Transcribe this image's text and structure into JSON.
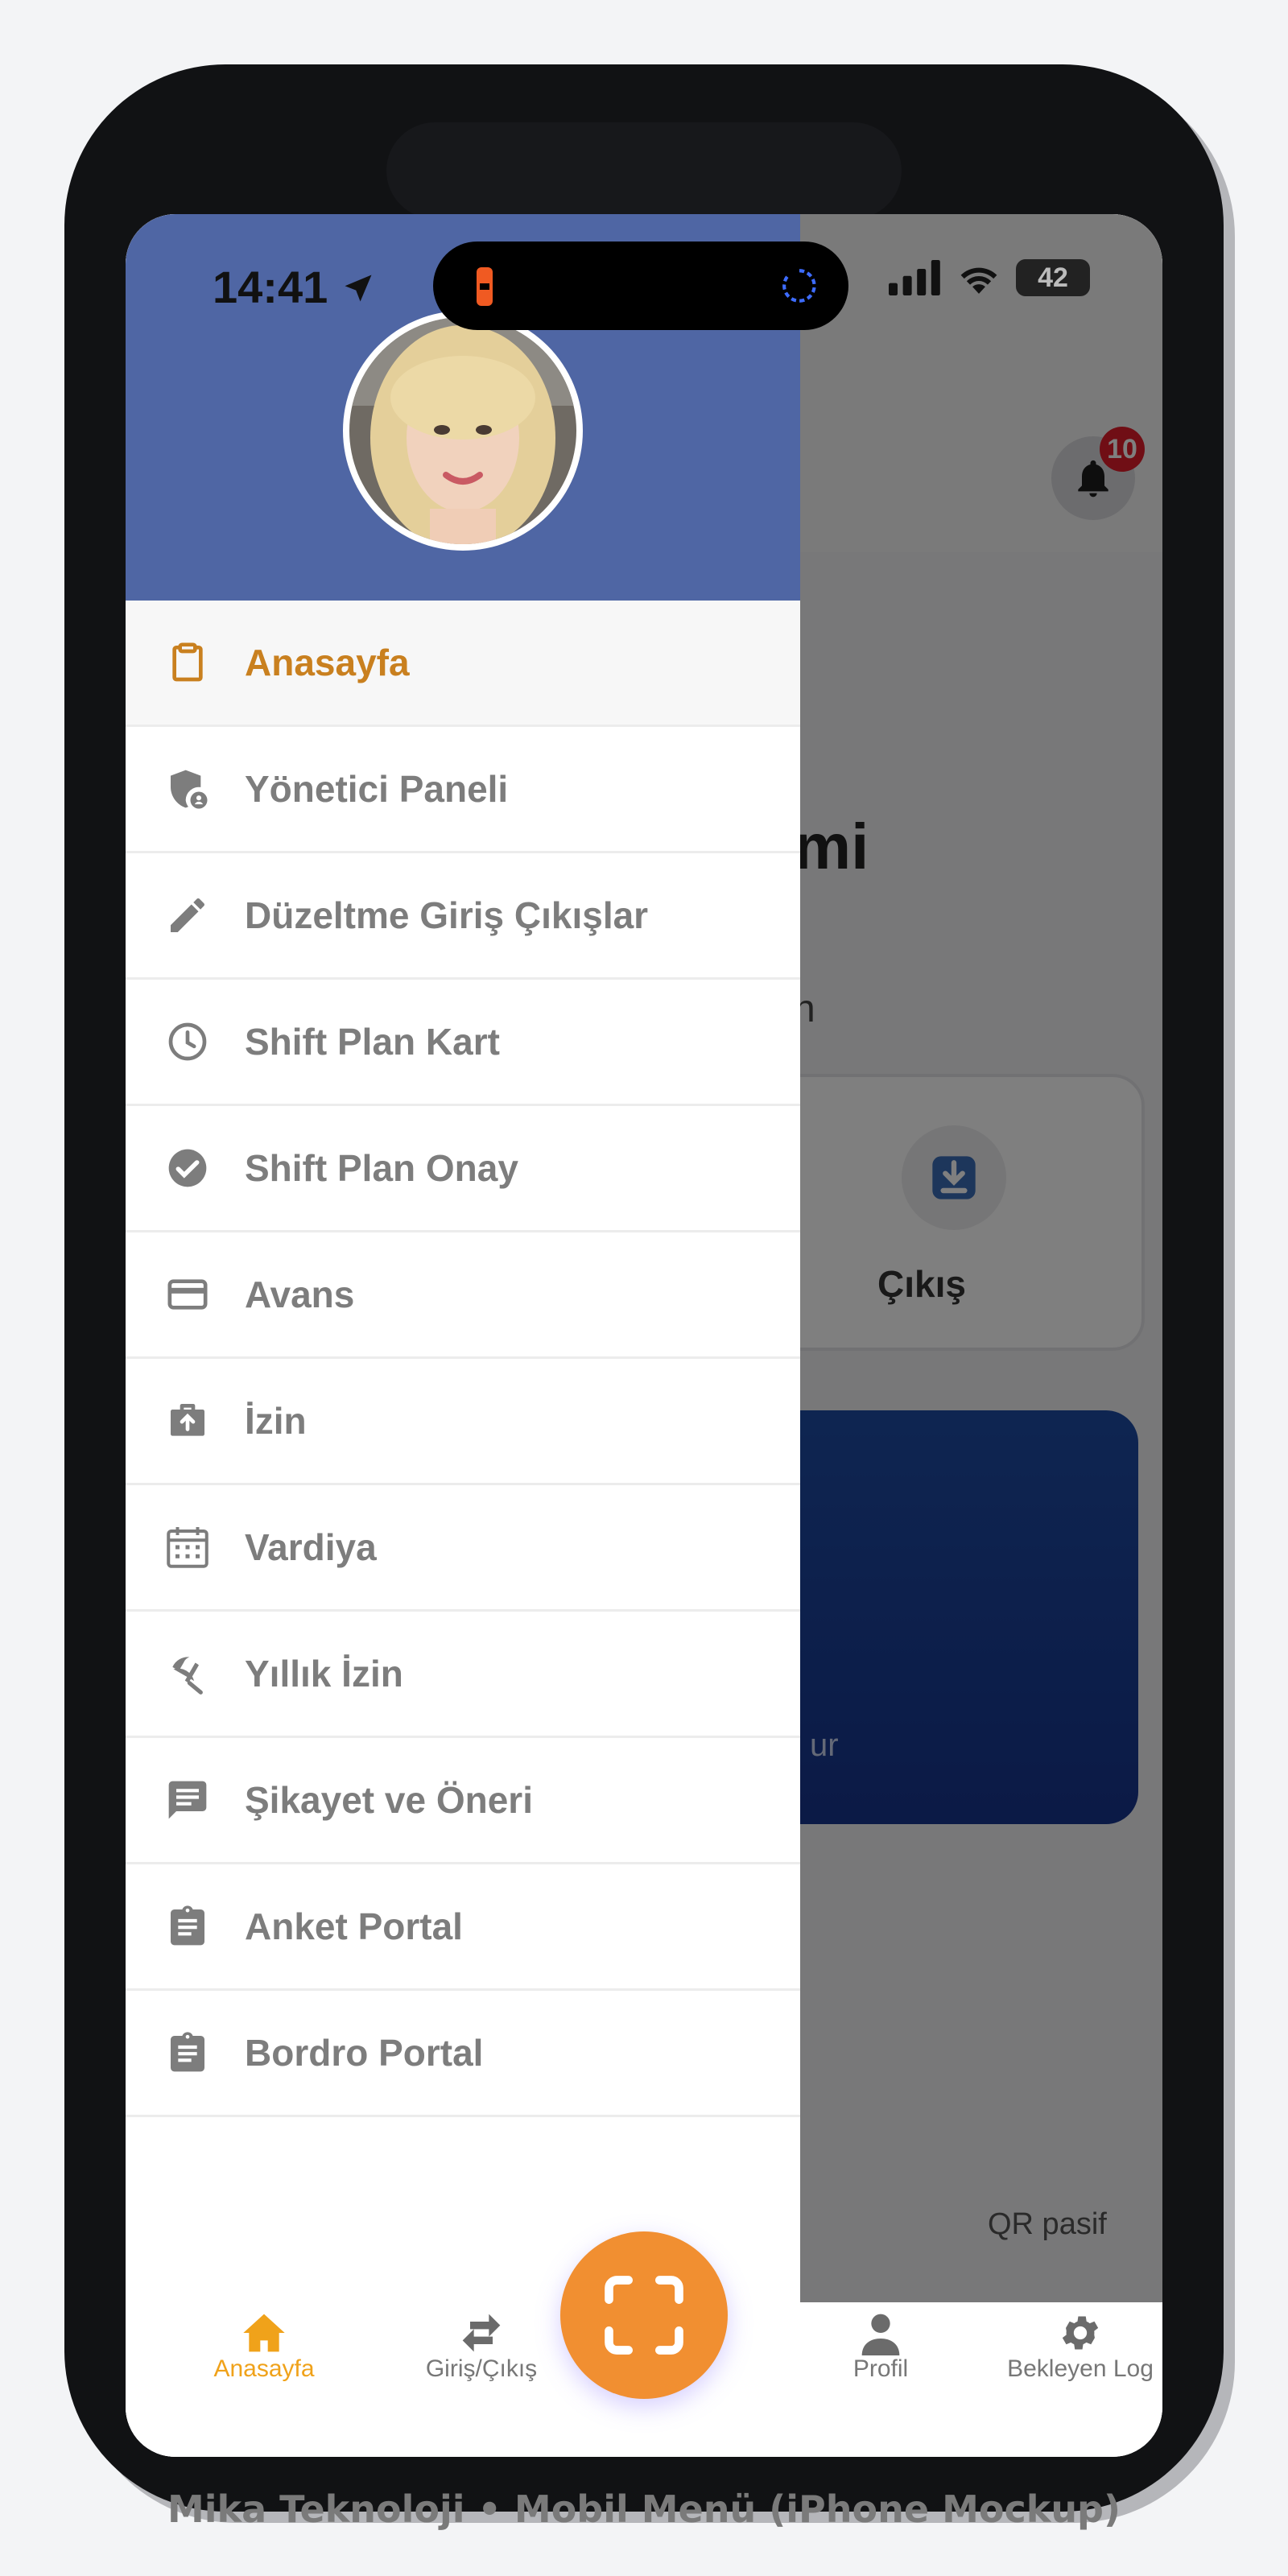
{
  "status_bar": {
    "time": "14:41",
    "battery": "42"
  },
  "background_app": {
    "notification_count": "10",
    "title_fragment": "mi",
    "subtitle_fragment": "n",
    "exit_card_label": "Çıkış",
    "blue_card_text_fragment": "ur",
    "qr_status": "QR pasif"
  },
  "drawer": {
    "menu": [
      {
        "label": "Anasayfa",
        "icon": "clipboard-icon"
      },
      {
        "label": "Yönetici Paneli",
        "icon": "admin-shield-icon"
      },
      {
        "label": "Düzeltme Giriş Çıkışlar",
        "icon": "pencil-icon"
      },
      {
        "label": "Shift Plan Kart",
        "icon": "clock-icon"
      },
      {
        "label": "Shift Plan Onay",
        "icon": "check-circle-icon"
      },
      {
        "label": "Avans",
        "icon": "credit-card-icon"
      },
      {
        "label": "İzin",
        "icon": "briefcase-icon"
      },
      {
        "label": "Vardiya",
        "icon": "calendar-icon"
      },
      {
        "label": "Yıllık İzin",
        "icon": "beach-umbrella-icon"
      },
      {
        "label": "Şikayet ve Öneri",
        "icon": "feedback-icon"
      },
      {
        "label": "Anket Portal",
        "icon": "assignment-icon"
      },
      {
        "label": "Bordro Portal",
        "icon": "assignment-icon"
      }
    ]
  },
  "tabbar": {
    "tabs": [
      {
        "label": "Anasayfa",
        "icon": "home-icon"
      },
      {
        "label": "Giriş/Çıkış",
        "icon": "swap-arrows-icon"
      },
      {
        "label": "Profil",
        "icon": "person-icon"
      },
      {
        "label": "Bekleyen Log",
        "icon": "gear-icon"
      }
    ],
    "scan_icon": "qr-scan-icon"
  },
  "colors": {
    "drawer_header": "#4f66a4",
    "active_accent": "#c9801f",
    "scan_button": "#f18f31",
    "badge": "#e11d2a"
  },
  "caption": "Mika Teknoloji • Mobil Menü (iPhone Mockup)"
}
